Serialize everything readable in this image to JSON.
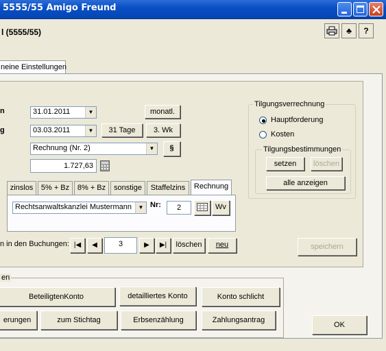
{
  "window": {
    "title": "5555/55 Amigo Freund"
  },
  "header": {
    "heading": "l (5555/55)"
  },
  "toolbar": {
    "print_icon": "printer-icon",
    "club_icon": "club-icon",
    "help": "?"
  },
  "main_tab": "neine Einstellungen",
  "left_labels": {
    "row1": "n",
    "row2": "g"
  },
  "date1": "31.01.2011",
  "date2": "03.03.2011",
  "buttons": {
    "monatl": "monatl.",
    "tage31": "31 Tage",
    "wk3": "3. Wk",
    "paragraph": "§",
    "setzen": "setzen",
    "loeschen": "löschen",
    "alle_anzeigen": "alle anzeigen",
    "wv": "Wv",
    "nav_loeschen": "löschen",
    "nav_neu": "neu",
    "speichern": "speichern",
    "ok": "OK"
  },
  "rechnung_select": "Rechnung (Nr. 2)",
  "amount": "1.727,63",
  "tilgungsverrechnung": {
    "legend": "Tilgungsverrechnung",
    "opt1": "Hauptforderung",
    "opt2": "Kosten"
  },
  "tilgungsbestimmungen": {
    "legend": "Tilgungsbestimmungen"
  },
  "inner_tabs": [
    "zinslos",
    "5% + Bz",
    "8% + Bz",
    "sonstige",
    "Staffelzins",
    "Rechnung"
  ],
  "kanzlei_select": "Rechtsanwaltskanzlei Mustermann",
  "nr_label": "Nr:",
  "nr_value": "2",
  "buchungen_label": "n in den Buchungen:",
  "record_number": "3",
  "bottom": {
    "legend": "en",
    "b1": "BeteiligtenKonto",
    "b2": "detailliertes Konto",
    "b3": "Konto schlicht",
    "b4": "erungen",
    "b5": "zum Stichtag",
    "b6": "Erbsenzählung",
    "b7": "Zahlungsantrag"
  }
}
